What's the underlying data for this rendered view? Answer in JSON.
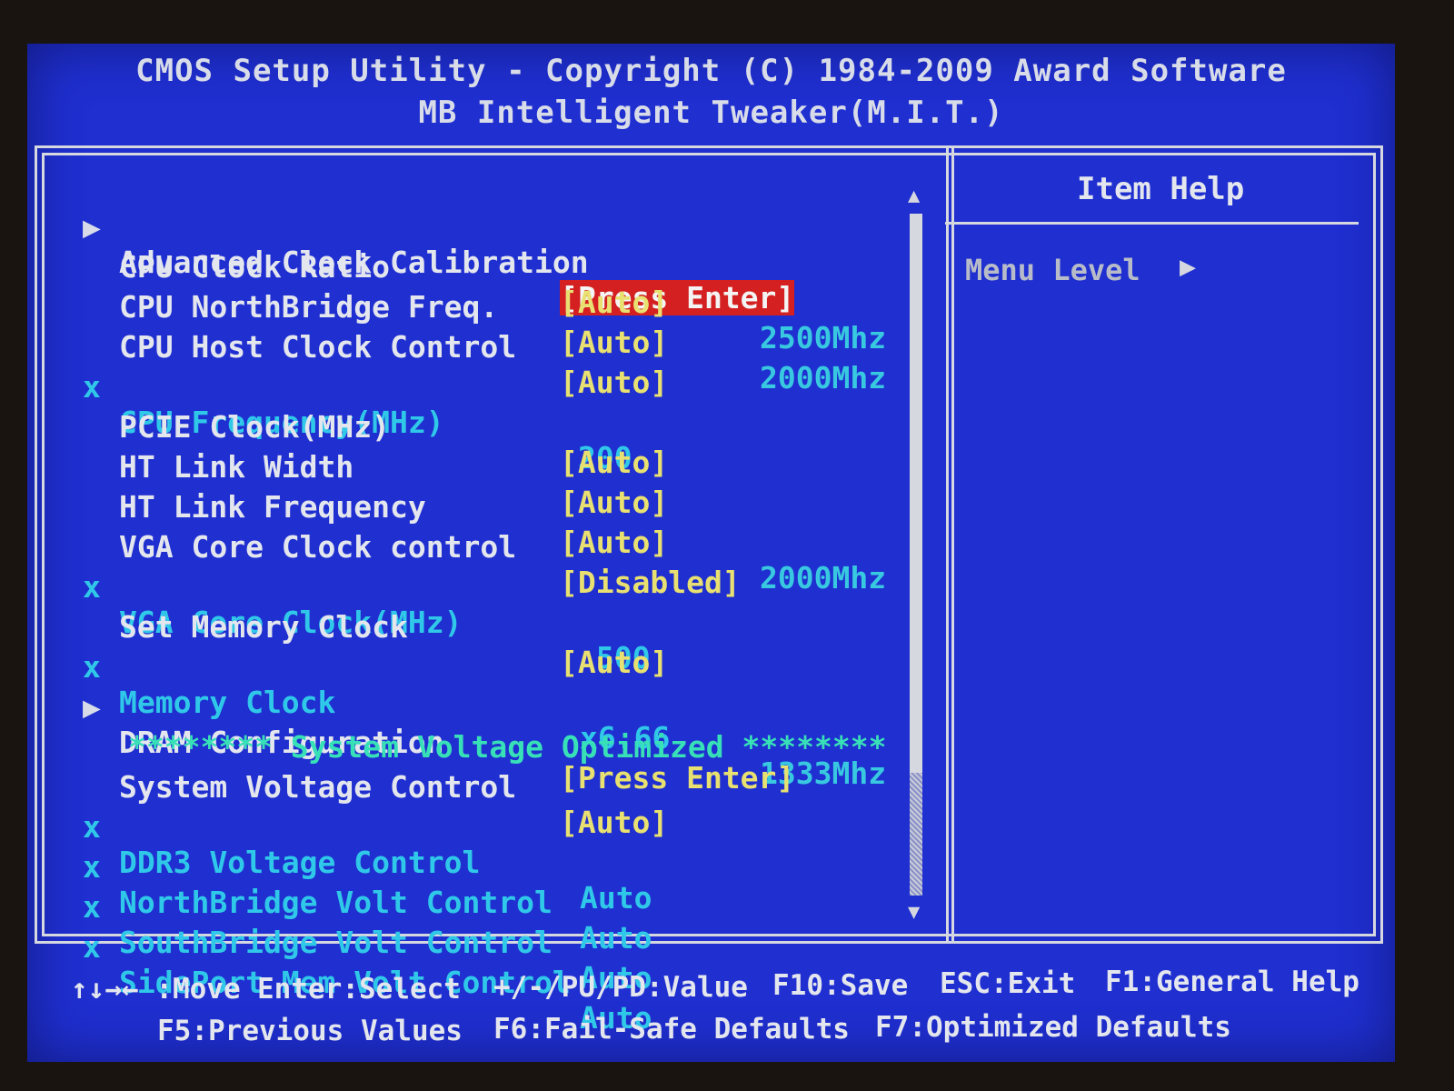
{
  "header": {
    "title": "CMOS Setup Utility - Copyright (C) 1984-2009 Award Software",
    "subtitle": "MB Intelligent Tweaker(M.I.T.)"
  },
  "menu": {
    "items": [
      {
        "marker": "▶",
        "label": "Advanced Clock Calibration",
        "value": "[Press Enter]",
        "freq": ""
      },
      {
        "marker": "",
        "label": "CPU Clock Ratio",
        "value": "[Auto]",
        "freq": "2500Mhz"
      },
      {
        "marker": "",
        "label": "CPU NorthBridge Freq.",
        "value": "[Auto]",
        "freq": "2000Mhz"
      },
      {
        "marker": "",
        "label": "CPU Host Clock Control",
        "value": "[Auto]",
        "freq": ""
      },
      {
        "marker": "x",
        "label": "CPU Frequency(MHz)",
        "value": "200",
        "freq": ""
      },
      {
        "marker": "",
        "label": "PCIE Clock(MHz)",
        "value": "[Auto]",
        "freq": ""
      },
      {
        "marker": "",
        "label": "HT Link Width",
        "value": "[Auto]",
        "freq": ""
      },
      {
        "marker": "",
        "label": "HT Link Frequency",
        "value": "[Auto]",
        "freq": "2000Mhz"
      },
      {
        "marker": "",
        "label": "VGA Core Clock control",
        "value": "[Disabled]",
        "freq": ""
      },
      {
        "marker": "x",
        "label": "VGA Core Clock(MHz)",
        "value": "500",
        "freq": ""
      },
      {
        "marker": "",
        "label": "Set Memory Clock",
        "value": "[Auto]",
        "freq": ""
      },
      {
        "marker": "x",
        "label": "Memory Clock",
        "value": "x6.66",
        "freq": "1333Mhz"
      },
      {
        "marker": "▶",
        "label": "DRAM Configuration",
        "value": "[Press Enter]",
        "freq": ""
      },
      {
        "marker": "",
        "label": "******** System Voltage Optimized ********",
        "value": "",
        "freq": ""
      },
      {
        "marker": "",
        "label": "System Voltage Control",
        "value": "[Auto]",
        "freq": ""
      },
      {
        "marker": "x",
        "label": "DDR3 Voltage Control",
        "value": "Auto",
        "freq": ""
      },
      {
        "marker": "x",
        "label": "NorthBridge Volt Control",
        "value": "Auto",
        "freq": ""
      },
      {
        "marker": "x",
        "label": "SouthBridge Volt Control",
        "value": "Auto",
        "freq": ""
      },
      {
        "marker": "x",
        "label": "SidePort Mem Volt Control",
        "value": "Auto",
        "freq": ""
      }
    ]
  },
  "scroll": {
    "up": "▲",
    "down": "▼"
  },
  "help": {
    "title": "Item Help",
    "menu_level": "Menu Level",
    "arrow": "▶"
  },
  "footer": {
    "move": "↑↓→← :Move",
    "select": "Enter:Select",
    "value": "+/-/PU/PD:Value",
    "save": "F10:Save",
    "exit": "ESC:Exit",
    "general_help": "F1:General Help",
    "previous": "F5:Previous Values",
    "failsafe": "F6:Fail-Safe Defaults",
    "optimized": "F7:Optimized Defaults"
  },
  "colors": {
    "background": "#1f2fd0",
    "highlight": "#d42020",
    "value": "#e8e070",
    "disabled": "#30c8e8"
  }
}
